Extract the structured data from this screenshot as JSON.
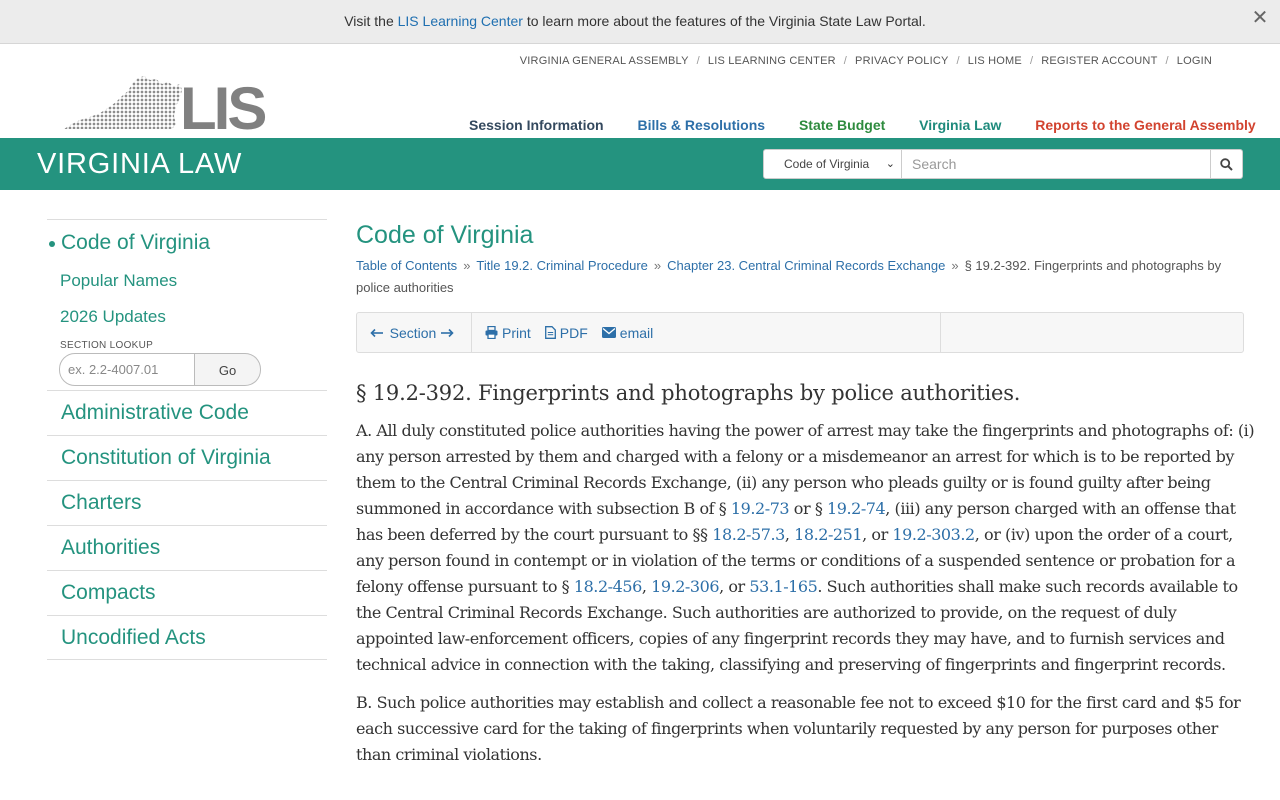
{
  "banner": {
    "prefix": "Visit the ",
    "link": "LIS Learning Center",
    "suffix": " to learn more about the features of the Virginia State Law Portal.",
    "close": "✕"
  },
  "utility_nav": [
    "VIRGINIA GENERAL ASSEMBLY",
    "LIS LEARNING CENTER",
    "PRIVACY POLICY",
    "LIS HOME",
    "REGISTER ACCOUNT",
    "LOGIN"
  ],
  "logo": {
    "text": "LIS"
  },
  "main_nav": {
    "session": "Session Information",
    "bills": "Bills & Resolutions",
    "budget": "State Budget",
    "law": "Virginia Law",
    "reports": "Reports to the General Assembly"
  },
  "header": {
    "section_title": "VIRGINIA LAW",
    "scope_selected": "Code of Virginia",
    "search_placeholder": "Search"
  },
  "sidebar": {
    "active": "Code of Virginia",
    "sub_items": [
      "Popular Names",
      "2026 Updates"
    ],
    "lookup_label": "SECTION LOOKUP",
    "lookup_placeholder": "ex. 2.2-4007.01",
    "lookup_go": "Go",
    "items": [
      "Administrative Code",
      "Constitution of Virginia",
      "Charters",
      "Authorities",
      "Compacts",
      "Uncodified Acts"
    ]
  },
  "main": {
    "title": "Code of Virginia",
    "breadcrumb": {
      "toc": "Table of Contents",
      "title": "Title 19.2. Criminal Procedure",
      "chapter": "Chapter 23. Central Criminal Records Exchange",
      "current": "§ 19.2-392. Fingerprints and photographs by police authorities"
    },
    "toolbar": {
      "section": "Section",
      "print": "Print",
      "pdf": "PDF",
      "email": "email"
    },
    "law_title": "§ 19.2-392. Fingerprints and photographs by police authorities.",
    "para_a": {
      "t1": "A. All duly constituted police authorities having the power of arrest may take the fingerprints and photographs of: (i) any person arrested by them and charged with a felony or a misdemeanor an arrest for which is to be reported by them to the Central Criminal Records Exchange, (ii) any person who pleads guilty or is found guilty after being summoned in accordance with subsection B of § ",
      "l1": "19.2-73",
      "t2": " or § ",
      "l2": "19.2-74",
      "t3": ", (iii) any person charged with an offense that has been deferred by the court pursuant to §§ ",
      "l3": "18.2-57.3",
      "t4": ", ",
      "l4": "18.2-251",
      "t5": ", or ",
      "l5": "19.2-303.2",
      "t6": ", or (iv) upon the order of a court, any person found in contempt or in violation of the terms or conditions of a suspended sentence or probation for a felony offense pursuant to § ",
      "l6": "18.2-456",
      "t7": ", ",
      "l7": "19.2-306",
      "t8": ", or ",
      "l8": "53.1-165",
      "t9": ". Such authorities shall make such records available to the Central Criminal Records Exchange. Such authorities are authorized to provide, on the request of duly appointed law-enforcement officers, copies of any fingerprint records they may have, and to furnish services and technical advice in connection with the taking, classifying and preserving of fingerprints and fingerprint records."
    },
    "para_b": "B. Such police authorities may establish and collect a reasonable fee not to exceed $10 for the first card and $5 for each successive card for the taking of fingerprints when voluntarily requested by any person for purposes other than criminal violations."
  }
}
